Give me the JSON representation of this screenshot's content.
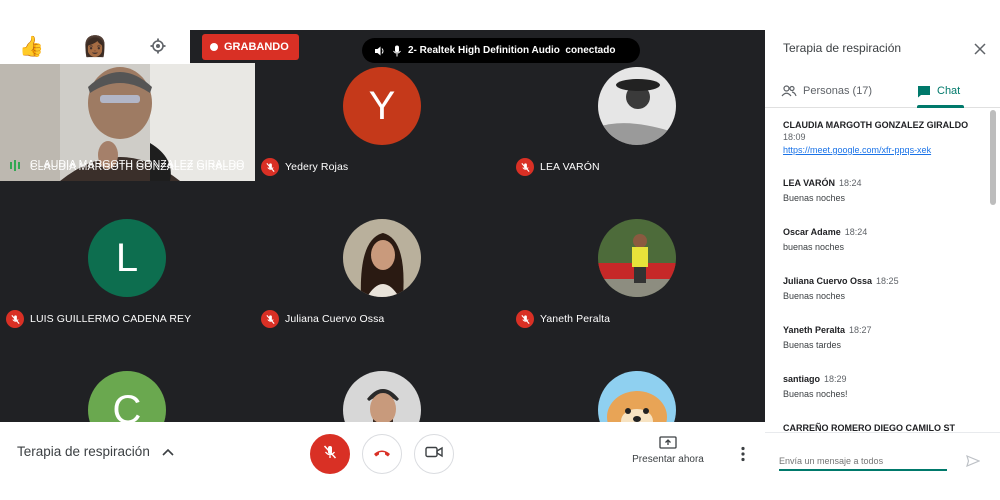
{
  "top_controls": {
    "reaction_emoji": "👍",
    "avatar_emoji": "👩🏾",
    "settings_icon": "gear-icon",
    "recording_label": "GRABANDO",
    "audio_status": "2- Realtek High Definition Audio  conectado"
  },
  "participants": [
    {
      "name": "CLAUDIA MARGOTH GONZALEZ GIRALDO",
      "kind": "video",
      "mic": "speaking"
    },
    {
      "name": "Yedery Rojas",
      "kind": "letter",
      "letter": "Y",
      "color": "#c5391a",
      "mic": "muted"
    },
    {
      "name": "LEA VARÓN",
      "kind": "photo",
      "mic": "muted"
    },
    {
      "name": "LUIS GUILLERMO CADENA REY",
      "kind": "letter",
      "letter": "L",
      "color": "#0d6e4f",
      "mic": "muted"
    },
    {
      "name": "Juliana Cuervo Ossa",
      "kind": "photo",
      "mic": "muted"
    },
    {
      "name": "Yaneth Peralta",
      "kind": "photo",
      "mic": "muted"
    },
    {
      "name": "",
      "kind": "letter",
      "letter": "C",
      "color": "#6aa84f",
      "mic": "none"
    },
    {
      "name": "",
      "kind": "photo",
      "mic": "none"
    },
    {
      "name": "",
      "kind": "photo",
      "mic": "none"
    }
  ],
  "bottom_bar": {
    "meeting_title": "Terapia de respiración",
    "present_label": "Presentar ahora"
  },
  "panel": {
    "title": "Terapia de respiración",
    "tab_people": "Personas (17)",
    "tab_chat": "Chat",
    "messages": [
      {
        "sender": "CLAUDIA MARGOTH GONZALEZ GIRALDO",
        "time": "18:09",
        "link": "https://meet.google.com/xfr-ppqs-xek"
      },
      {
        "sender": "LEA VARÓN",
        "time": "18:24",
        "text": "Buenas noches"
      },
      {
        "sender": "Oscar Adame",
        "time": "18:24",
        "text": "buenas noches"
      },
      {
        "sender": "Juliana Cuervo Ossa",
        "time": "18:25",
        "text": "Buenas noches"
      },
      {
        "sender": "Yaneth Peralta",
        "time": "18:27",
        "text": "Buenas tardes"
      },
      {
        "sender": "santiago",
        "time": "18:29",
        "text": "Buenas noches!"
      },
      {
        "sender": "CARREÑO ROMERO DIEGO CAMILO ST",
        "time": ""
      }
    ],
    "input_placeholder": "Envía un mensaje a todos"
  },
  "colors": {
    "grid_bg": "#202124",
    "accent": "#00796b",
    "record_red": "#d93025",
    "link_blue": "#1a73e8"
  }
}
